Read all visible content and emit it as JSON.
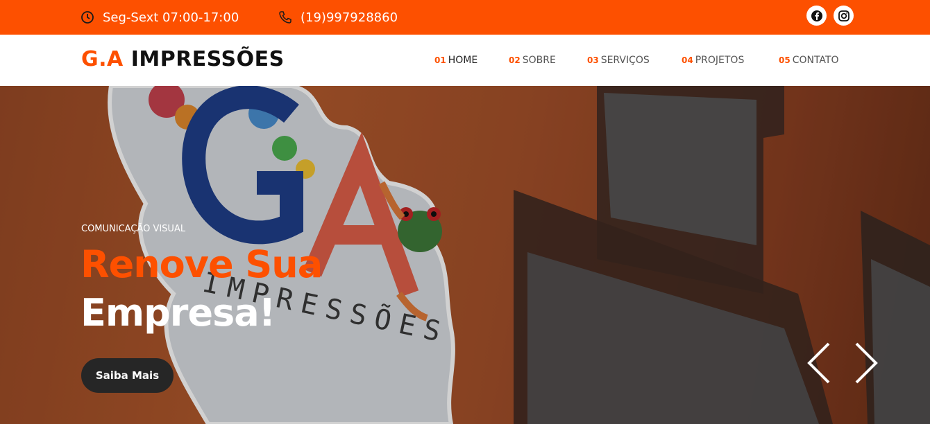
{
  "topbar": {
    "hours": "Seg-Sext 07:00-17:00",
    "phone": "(19)997928860",
    "icons": {
      "hours": "clock-icon",
      "phone": "phone-icon",
      "facebook": "facebook-icon",
      "instagram": "instagram-icon"
    }
  },
  "header": {
    "logo_brand": "G.A",
    "logo_rest": "IMPRESSÕES",
    "nav": [
      {
        "num": "01",
        "label": "HOME"
      },
      {
        "num": "02",
        "label": "SOBRE"
      },
      {
        "num": "03",
        "label": "SERVIÇOS"
      },
      {
        "num": "04",
        "label": "PROJETOS"
      },
      {
        "num": "05",
        "label": "CONTATO"
      }
    ]
  },
  "hero": {
    "eyebrow": "COMUNICAÇÃO VISUAL",
    "title_line1": "Renove Sua",
    "title_line2": "Empresa!",
    "cta": "Saiba Mais",
    "sign_text": "IMPRESSÕES",
    "sign_letters": "GA"
  },
  "colors": {
    "accent": "#fd5000",
    "dark": "#262626",
    "white": "#ffffff"
  }
}
